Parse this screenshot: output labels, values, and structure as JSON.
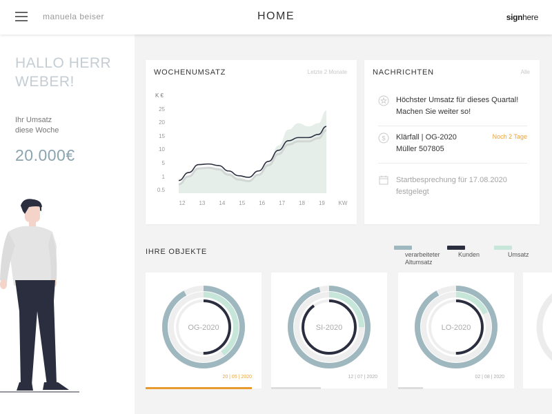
{
  "header": {
    "user_name": "manuela beiser",
    "title": "HOME",
    "logo_bold": "sign",
    "logo_rest": "here"
  },
  "left_panel": {
    "greeting_line1": "HALLO HERR",
    "greeting_line2": "WEBER!",
    "revenue_label_line1": "Ihr Umsatz",
    "revenue_label_line2": "diese Woche",
    "revenue_value": "20.000€"
  },
  "weekly_revenue": {
    "title": "WOCHENUMSATZ",
    "range_link": "Letzte 2 Monate",
    "unit_label": "K €",
    "x_unit": "KW"
  },
  "chart_data": {
    "type": "line",
    "x_ticks": [
      12,
      13,
      14,
      15,
      16,
      17,
      18,
      19
    ],
    "y_ticks": [
      "25",
      "20",
      "15",
      "10",
      "5",
      "1",
      "0.5"
    ],
    "xlabel": "KW",
    "ylabel": "K €",
    "series": [
      {
        "name": "",
        "kind": "area",
        "color": "#e6eeea",
        "x": [
          12,
          12.5,
          13,
          13.5,
          14,
          14.5,
          15,
          15.5,
          16,
          16.5,
          17,
          17.5,
          18,
          18.5,
          19,
          19.4
        ],
        "y": [
          2.5,
          5,
          8,
          8.3,
          8,
          6.5,
          5,
          4.2,
          6,
          9.5,
          15,
          20,
          22,
          21,
          22,
          26
        ]
      },
      {
        "name": "",
        "kind": "line",
        "color": "#2a2e3e",
        "x": [
          12,
          12.5,
          13,
          13.5,
          14,
          14.5,
          15,
          15.5,
          16,
          16.5,
          17,
          17.5,
          18,
          18.5,
          19,
          19.4
        ],
        "y": [
          4,
          6.5,
          9,
          9.2,
          8.7,
          7,
          5.5,
          5,
          7,
          10,
          13.5,
          16.5,
          17.5,
          17.5,
          18.5,
          21
        ]
      }
    ]
  },
  "messages": {
    "title": "NACHRICHTEN",
    "all_link": "Alle",
    "items": [
      {
        "icon": "star-icon",
        "line1": "Höchster Umsatz für dieses Quartal!",
        "line2": "Machen Sie weiter so!",
        "tag": ""
      },
      {
        "icon": "dollar-icon",
        "line1": "Klärfall | OG-2020",
        "line2": "Müller 507805",
        "tag": "Noch 2 Tage"
      },
      {
        "icon": "calendar-icon",
        "line1": "Startbesprechung für 17.08.2020",
        "line2": "festgelegt",
        "tag": ""
      }
    ]
  },
  "objects": {
    "title": "IHRE OBJEKTE",
    "legend": [
      {
        "label_line1": "verarbeiteter",
        "label_line2": "Altumsatz",
        "color": "#9fb8bf"
      },
      {
        "label_line1": "Kunden",
        "label_line2": "",
        "color": "#2a2e3e"
      },
      {
        "label_line1": "Umsatz",
        "label_line2": "",
        "color": "#c5e6d8"
      }
    ],
    "cards": [
      {
        "name": "OG-2020",
        "date": "20 | 05 | 2020",
        "active": true,
        "outer_pct": 0.92,
        "middle_pct": 0.4,
        "inner_pct": 0.5
      },
      {
        "name": "SI-2020",
        "date": "12 | 07 | 2020",
        "active": false,
        "outer_pct": 0.96,
        "middle_pct": 0.25,
        "inner_pct": 0.9
      },
      {
        "name": "LO-2020",
        "date": "02 | 08 | 2020",
        "active": false,
        "outer_pct": 0.92,
        "middle_pct": 0.18,
        "inner_pct": 0.5
      }
    ]
  }
}
